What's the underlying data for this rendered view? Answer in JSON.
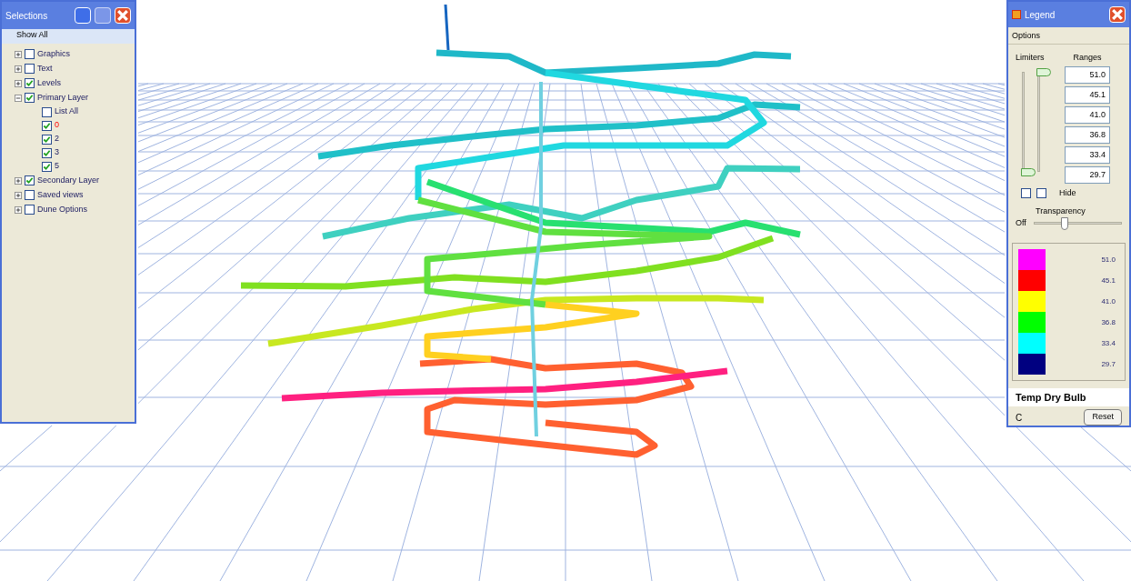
{
  "selection_window": {
    "title": "Selections",
    "menu": "Show All",
    "tree": [
      {
        "label": "Graphics",
        "checked": false,
        "expanded": false
      },
      {
        "label": "Text",
        "checked": false,
        "expanded": false
      },
      {
        "label": "Levels",
        "checked": true,
        "expanded": false
      },
      {
        "label": "Primary Layer",
        "checked": true,
        "expanded": true,
        "children": [
          {
            "label": "List All",
            "checked": false,
            "highlighted": false
          },
          {
            "label": "0",
            "checked": true,
            "highlighted": true
          },
          {
            "label": "2",
            "checked": true,
            "highlighted": false
          },
          {
            "label": "3",
            "checked": true,
            "highlighted": false
          },
          {
            "label": "5",
            "checked": true,
            "highlighted": false
          }
        ]
      },
      {
        "label": "Secondary Layer",
        "checked": true,
        "expanded": false
      },
      {
        "label": "Saved views",
        "checked": false,
        "expanded": false
      },
      {
        "label": "Dune Options",
        "checked": false,
        "expanded": false
      }
    ]
  },
  "legend_window": {
    "title": "Legend",
    "menu": "Options",
    "limiters_label": "Limiters",
    "ranges_label": "Ranges",
    "limiters": [
      {
        "level": 0
      },
      {
        "level": 1
      }
    ],
    "ranges": [
      "51.0",
      "45.1",
      "41.0",
      "36.8",
      "33.4",
      "29.7"
    ],
    "hide_checks": [
      {
        "checked": false
      },
      {
        "checked": false
      }
    ],
    "hide_label": "Hide",
    "transparency_label": "Transparency",
    "transparency_off": "Off",
    "transparency": {
      "level": 0.35
    },
    "entries": [
      {
        "color": "#ff00ff",
        "value": "51.0"
      },
      {
        "color": "#ff0000",
        "value": "45.1"
      },
      {
        "color": "#ffff00",
        "value": "41.0"
      },
      {
        "color": "#00ff00",
        "value": "36.8"
      },
      {
        "color": "#00ffff",
        "value": "33.4"
      },
      {
        "color": "#000080",
        "value": "29.7"
      }
    ],
    "variable": "Temp Dry Bulb",
    "unit": "C",
    "reset": "Reset"
  }
}
